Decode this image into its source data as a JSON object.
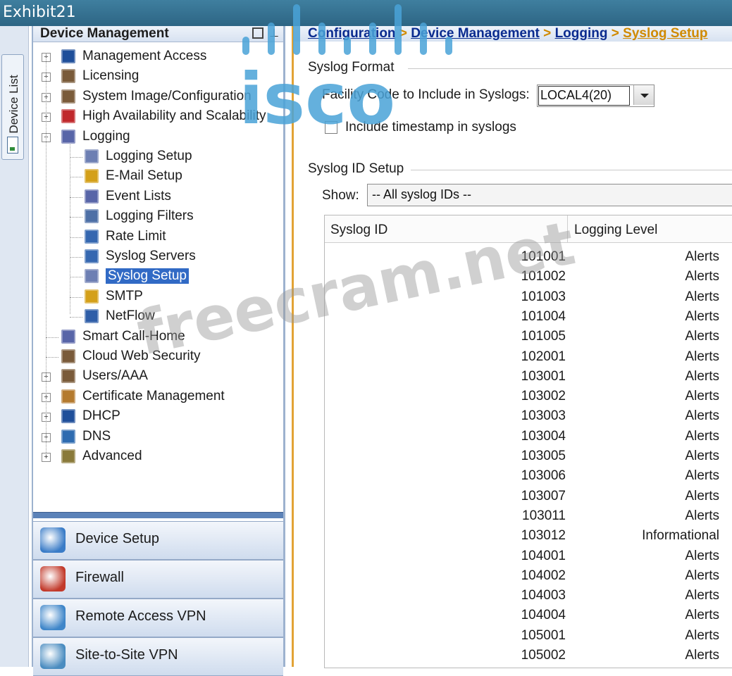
{
  "window": {
    "title": "Exhibit21"
  },
  "device_list_tab": "Device List",
  "left_pane": {
    "header": "Device Management",
    "tree": [
      {
        "label": "Management Access",
        "level": 0,
        "expander": "+",
        "icon": "ip-icon"
      },
      {
        "label": "Licensing",
        "level": 0,
        "expander": "+",
        "icon": "users-icon"
      },
      {
        "label": "System Image/Configuration",
        "level": 0,
        "expander": "+",
        "icon": "users-icon"
      },
      {
        "label": "High Availability and Scalability",
        "level": 0,
        "expander": "+",
        "icon": "box-icon"
      },
      {
        "label": "Logging",
        "level": 0,
        "expander": "-",
        "icon": "list-icon"
      },
      {
        "label": "Logging Setup",
        "level": 1,
        "icon": "setup-icon"
      },
      {
        "label": "E-Mail Setup",
        "level": 1,
        "icon": "mail-icon"
      },
      {
        "label": "Event Lists",
        "level": 1,
        "icon": "list-icon"
      },
      {
        "label": "Logging Filters",
        "level": 1,
        "icon": "filter-icon"
      },
      {
        "label": "Rate Limit",
        "level": 1,
        "icon": "server-icon"
      },
      {
        "label": "Syslog Servers",
        "level": 1,
        "icon": "server-icon"
      },
      {
        "label": "Syslog Setup",
        "level": 1,
        "icon": "setup-icon",
        "selected": true
      },
      {
        "label": "SMTP",
        "level": 1,
        "icon": "mail-icon"
      },
      {
        "label": "NetFlow",
        "level": 1,
        "icon": "netflow-icon"
      },
      {
        "label": "Smart Call-Home",
        "level": 0,
        "icon": "list-icon"
      },
      {
        "label": "Cloud Web Security",
        "level": 0,
        "icon": "users-icon"
      },
      {
        "label": "Users/AAA",
        "level": 0,
        "expander": "+",
        "icon": "users-icon"
      },
      {
        "label": "Certificate Management",
        "level": 0,
        "expander": "+",
        "icon": "cert-icon"
      },
      {
        "label": "DHCP",
        "level": 0,
        "expander": "+",
        "icon": "ip-icon"
      },
      {
        "label": "DNS",
        "level": 0,
        "expander": "+",
        "icon": "dns-icon"
      },
      {
        "label": "Advanced",
        "level": 0,
        "expander": "+",
        "icon": "advanced-icon"
      }
    ],
    "nav_buttons": [
      {
        "label": "Device Setup",
        "icon": "device-setup-icon"
      },
      {
        "label": "Firewall",
        "icon": "firewall-icon"
      },
      {
        "label": "Remote Access VPN",
        "icon": "remote-vpn-icon"
      },
      {
        "label": "Site-to-Site VPN",
        "icon": "site-vpn-icon"
      }
    ]
  },
  "breadcrumb": {
    "items": [
      "Configuration",
      "Device Management",
      "Logging",
      "Syslog Setup"
    ],
    "separator": ">"
  },
  "syslog_format": {
    "group_title": "Syslog Format",
    "facility_label": "Facility Code to Include in Syslogs:",
    "facility_value": "LOCAL4(20)",
    "timestamp_label": "Include timestamp in syslogs",
    "timestamp_checked": false
  },
  "syslog_id_setup": {
    "group_title": "Syslog ID Setup",
    "show_label": "Show:",
    "show_value": "-- All syslog IDs --",
    "columns": [
      "Syslog ID",
      "Logging Level"
    ],
    "rows": [
      {
        "id": "101001",
        "level": "Alerts"
      },
      {
        "id": "101002",
        "level": "Alerts"
      },
      {
        "id": "101003",
        "level": "Alerts"
      },
      {
        "id": "101004",
        "level": "Alerts"
      },
      {
        "id": "101005",
        "level": "Alerts"
      },
      {
        "id": "102001",
        "level": "Alerts"
      },
      {
        "id": "103001",
        "level": "Alerts"
      },
      {
        "id": "103002",
        "level": "Alerts"
      },
      {
        "id": "103003",
        "level": "Alerts"
      },
      {
        "id": "103004",
        "level": "Alerts"
      },
      {
        "id": "103005",
        "level": "Alerts"
      },
      {
        "id": "103006",
        "level": "Alerts"
      },
      {
        "id": "103007",
        "level": "Alerts"
      },
      {
        "id": "103011",
        "level": "Alerts"
      },
      {
        "id": "103012",
        "level": "Informational"
      },
      {
        "id": "104001",
        "level": "Alerts"
      },
      {
        "id": "104002",
        "level": "Alerts"
      },
      {
        "id": "104003",
        "level": "Alerts"
      },
      {
        "id": "104004",
        "level": "Alerts"
      },
      {
        "id": "105001",
        "level": "Alerts"
      },
      {
        "id": "105002",
        "level": "Alerts"
      }
    ]
  },
  "watermarks": {
    "logo": "cisco",
    "text": "freecram.net"
  },
  "colors": {
    "accent": "#316ac5",
    "logo_blue": "#4aa3d8",
    "breadcrumb_link": "#0a2b8f",
    "breadcrumb_current": "#d08a00"
  }
}
